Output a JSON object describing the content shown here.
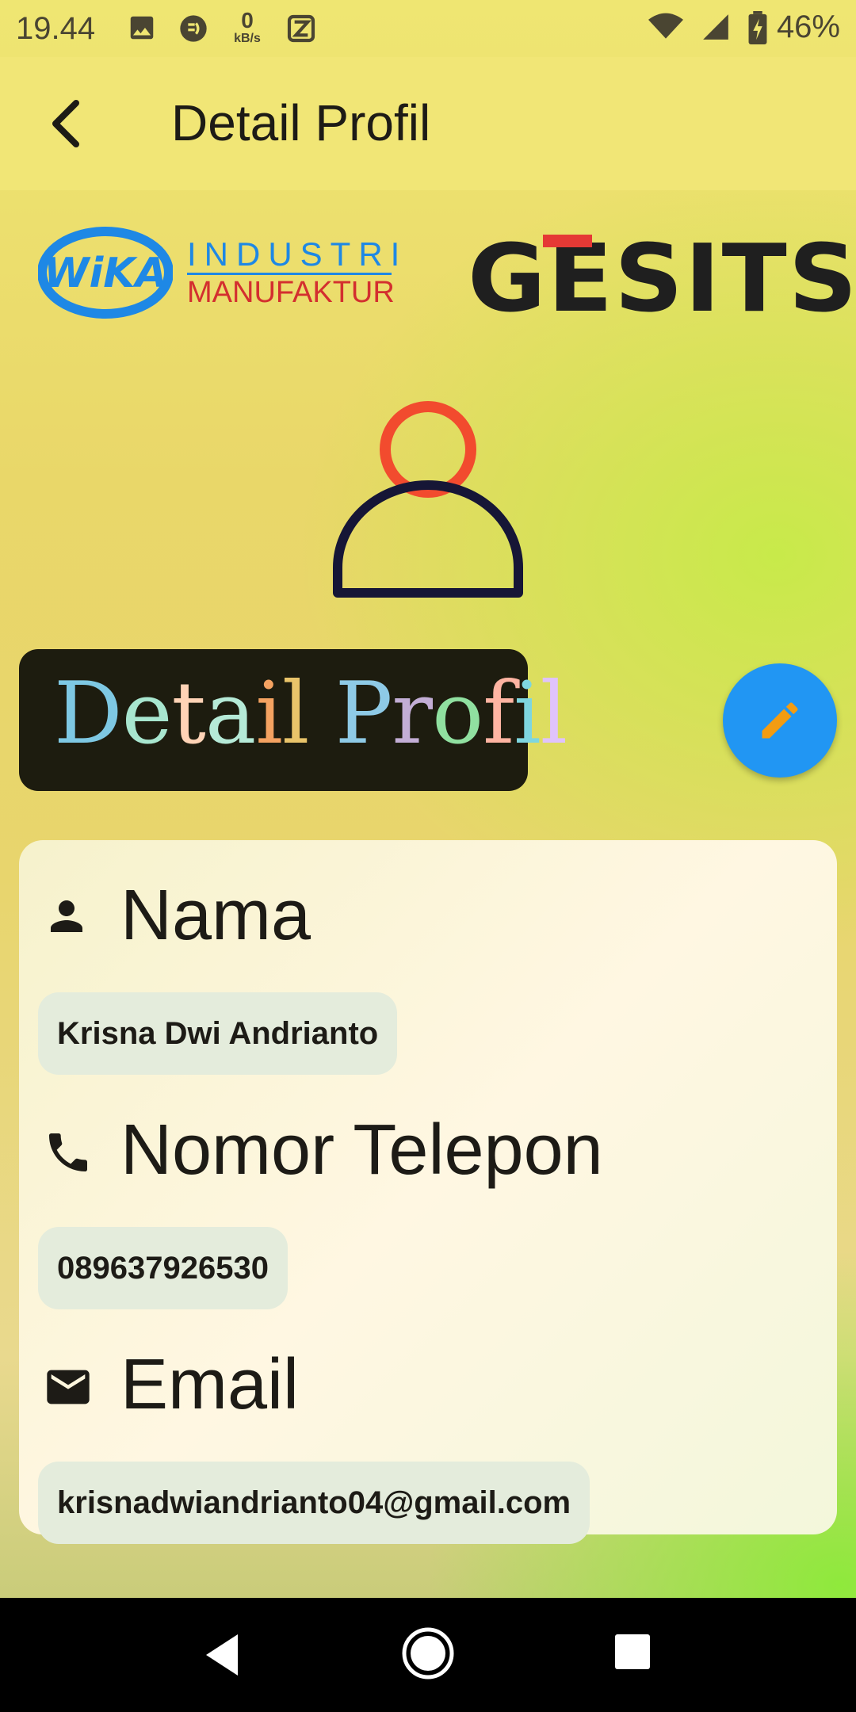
{
  "status_bar": {
    "time": "19.44",
    "network_speed_value": "0",
    "network_speed_unit": "kB/s",
    "battery": "46%",
    "icons": [
      "image-icon",
      "chat-icon",
      "z-app-icon",
      "wifi-icon",
      "signal-icon",
      "battery-icon"
    ]
  },
  "app_bar": {
    "title": "Detail Profil",
    "back_icon": "arrow-back-icon"
  },
  "logos": {
    "wika_mark": "WiKA",
    "wika_line1": "INDUSTRI",
    "wika_line2": "MANUFAKTUR",
    "gesits": "GESITS"
  },
  "section_heading": {
    "text": "Detail Profil",
    "letter_colors": [
      "#7ec8e3",
      "#a8e6cf",
      "#ffd3b6",
      "#b5ead7",
      "#f4a261",
      "#e9c46a",
      "#8ecae6",
      "#c3aed6",
      "#90e0a0",
      "#ffb4a2",
      "#7ed6df",
      "#e0c3fc",
      "#f7d794"
    ]
  },
  "edit_button": {
    "icon": "pencil-icon"
  },
  "profile": {
    "name": {
      "icon": "person-icon",
      "label": "Nama",
      "value": "Krisna Dwi Andrianto"
    },
    "phone": {
      "icon": "phone-icon",
      "label": "Nomor Telepon",
      "value": "089637926530"
    },
    "email": {
      "icon": "mail-icon",
      "label": "Email",
      "value": "krisnadwiandrianto04@gmail.com"
    }
  },
  "colors": {
    "app_bar": "#f1e676",
    "fab": "#2196f3",
    "fab_icon": "#f39c12",
    "avatar_head": "#f24b2e",
    "avatar_body": "#161636",
    "wika_blue": "#1e88e5",
    "wika_red": "#d32f2f",
    "gesits_red": "#e53935"
  },
  "nav_bar": {
    "buttons": [
      "back-triangle-icon",
      "home-circle-icon",
      "recents-square-icon"
    ]
  }
}
